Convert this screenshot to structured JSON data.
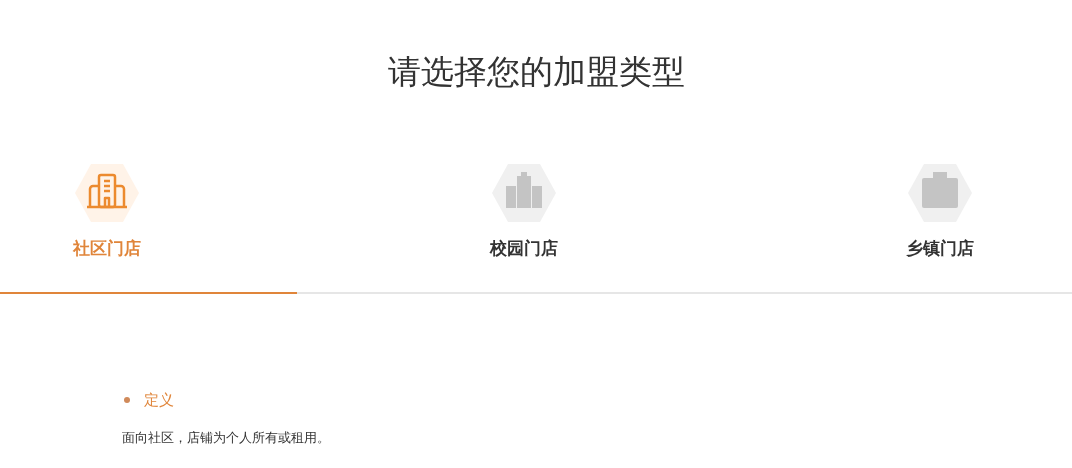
{
  "title": "请选择您的加盟类型",
  "tabs": [
    {
      "label": "社区门店",
      "selected": true
    },
    {
      "label": "校园门店",
      "selected": false
    },
    {
      "label": "乡镇门店",
      "selected": false
    }
  ],
  "section": {
    "heading": "定义",
    "text": "面向社区，店铺为个人所有或租用。"
  }
}
